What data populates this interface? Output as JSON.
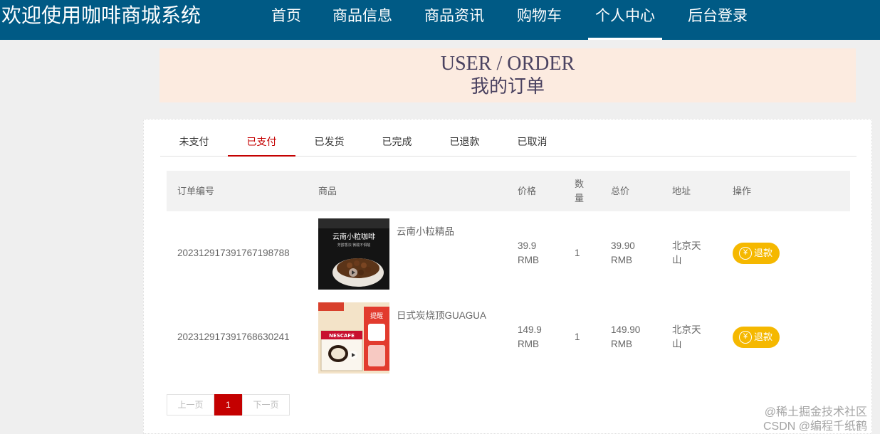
{
  "header": {
    "site_title": "欢迎使用咖啡商城系统",
    "nav": [
      "首页",
      "商品信息",
      "商品资讯",
      "购物车",
      "个人中心",
      "后台登录"
    ],
    "active_nav": "个人中心"
  },
  "banner": {
    "title_en": "USER / ORDER",
    "title_cn": "我的订单"
  },
  "tabs": {
    "items": [
      "未支付",
      "已支付",
      "已发货",
      "已完成",
      "已退款",
      "已取消"
    ],
    "active": "已支付"
  },
  "table": {
    "headers": {
      "order_no": "订单编号",
      "product": "商品",
      "price": "价格",
      "qty": "数量",
      "total": "总价",
      "address": "地址",
      "action": "操作"
    },
    "rows": [
      {
        "order_no": "20231291739176719878‌8",
        "product_name": "云南小粒精品",
        "image_text_1": "云南小粒咖啡",
        "image_text_2": "芳醇香浓 微酸不惧酸",
        "price": "39.9",
        "price_unit": "RMB",
        "qty": "1",
        "total": "39.90",
        "total_unit": "RMB",
        "address_1": "北京天",
        "address_2": "山",
        "action": "退款"
      },
      {
        "order_no": "202312917391768630241",
        "product_name": "日式炭烧顶GUAGUA",
        "image_text_1": "NESCAFE",
        "image_text_2": "提醒",
        "price": "149.9",
        "price_unit": "RMB",
        "qty": "1",
        "total": "149.90",
        "total_unit": "RMB",
        "address_1": "北京天",
        "address_2": "山",
        "action": "退款"
      }
    ]
  },
  "pagination": {
    "prev": "上一页",
    "current": "1",
    "next": "下一页"
  },
  "watermark": {
    "line1": "@稀土掘金技术社区",
    "line2": "CSDN @编程千纸鹤"
  },
  "colors": {
    "header_bg": "#005a85",
    "banner_bg": "#fcebe0",
    "accent_red": "#c40000",
    "refund_btn": "#f5b800"
  },
  "icons": {
    "refund": "yen-icon",
    "play": "play-icon"
  }
}
